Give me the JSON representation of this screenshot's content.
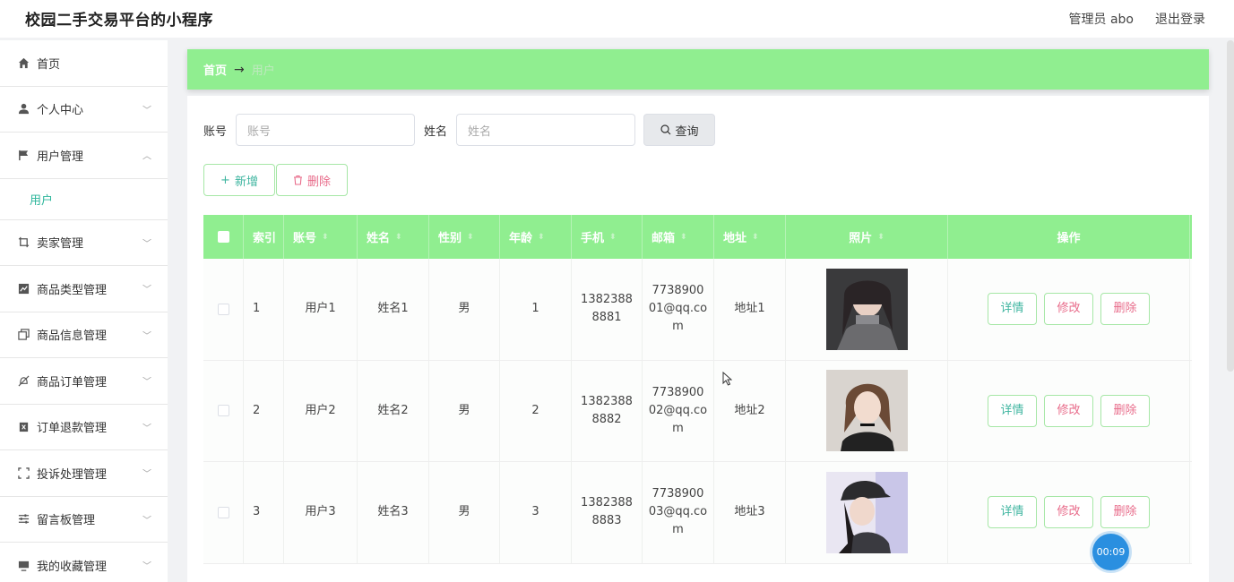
{
  "header": {
    "app_title": "校园二手交易平台的小程序",
    "user_info": "管理员 abo",
    "logout": "退出登录"
  },
  "sidebar": {
    "items": [
      {
        "label": "首页",
        "icon": "home-icon",
        "expandable": false
      },
      {
        "label": "个人中心",
        "icon": "user-icon",
        "expandable": true
      },
      {
        "label": "用户管理",
        "icon": "flag-icon",
        "expandable": true,
        "expanded": true
      },
      {
        "label": "卖家管理",
        "icon": "crop-icon",
        "expandable": true
      },
      {
        "label": "商品类型管理",
        "icon": "chart-icon",
        "expandable": true
      },
      {
        "label": "商品信息管理",
        "icon": "copy-icon",
        "expandable": true
      },
      {
        "label": "商品订单管理",
        "icon": "bell-off-icon",
        "expandable": true
      },
      {
        "label": "订单退款管理",
        "icon": "trash-box-icon",
        "expandable": true
      },
      {
        "label": "投诉处理管理",
        "icon": "full-screen-icon",
        "expandable": true
      },
      {
        "label": "留言板管理",
        "icon": "sliders-icon",
        "expandable": true
      },
      {
        "label": "我的收藏管理",
        "icon": "monitor-icon",
        "expandable": true
      }
    ],
    "submenu_active": "用户"
  },
  "breadcrumb": {
    "home": "首页",
    "arrow": "→",
    "current": "用户"
  },
  "search": {
    "account_label": "账号",
    "account_placeholder": "账号",
    "name_label": "姓名",
    "name_placeholder": "姓名",
    "query_button": "查询"
  },
  "actions": {
    "add": "新增",
    "delete": "删除"
  },
  "table": {
    "headers": [
      "索引",
      "账号",
      "姓名",
      "性别",
      "年龄",
      "手机",
      "邮箱",
      "地址",
      "照片",
      "操作"
    ],
    "rows": [
      {
        "index": "1",
        "account": "用户1",
        "name": "姓名1",
        "gender": "男",
        "age": "1",
        "phone": "13823888881",
        "email": "773890001@qq.com",
        "address": "地址1"
      },
      {
        "index": "2",
        "account": "用户2",
        "name": "姓名2",
        "gender": "男",
        "age": "2",
        "phone": "13823888882",
        "email": "773890002@qq.com",
        "address": "地址2"
      },
      {
        "index": "3",
        "account": "用户3",
        "name": "姓名3",
        "gender": "男",
        "age": "3",
        "phone": "13823888883",
        "email": "773890003@qq.com",
        "address": "地址3"
      }
    ],
    "ops": {
      "detail": "详情",
      "edit": "修改",
      "delete": "删除"
    }
  },
  "timer": "00:09",
  "colors": {
    "accent_green": "#90ee90",
    "teal_text": "#3fb5a0",
    "pink_text": "#e86b8a",
    "timer_blue": "#2a8fe0"
  }
}
